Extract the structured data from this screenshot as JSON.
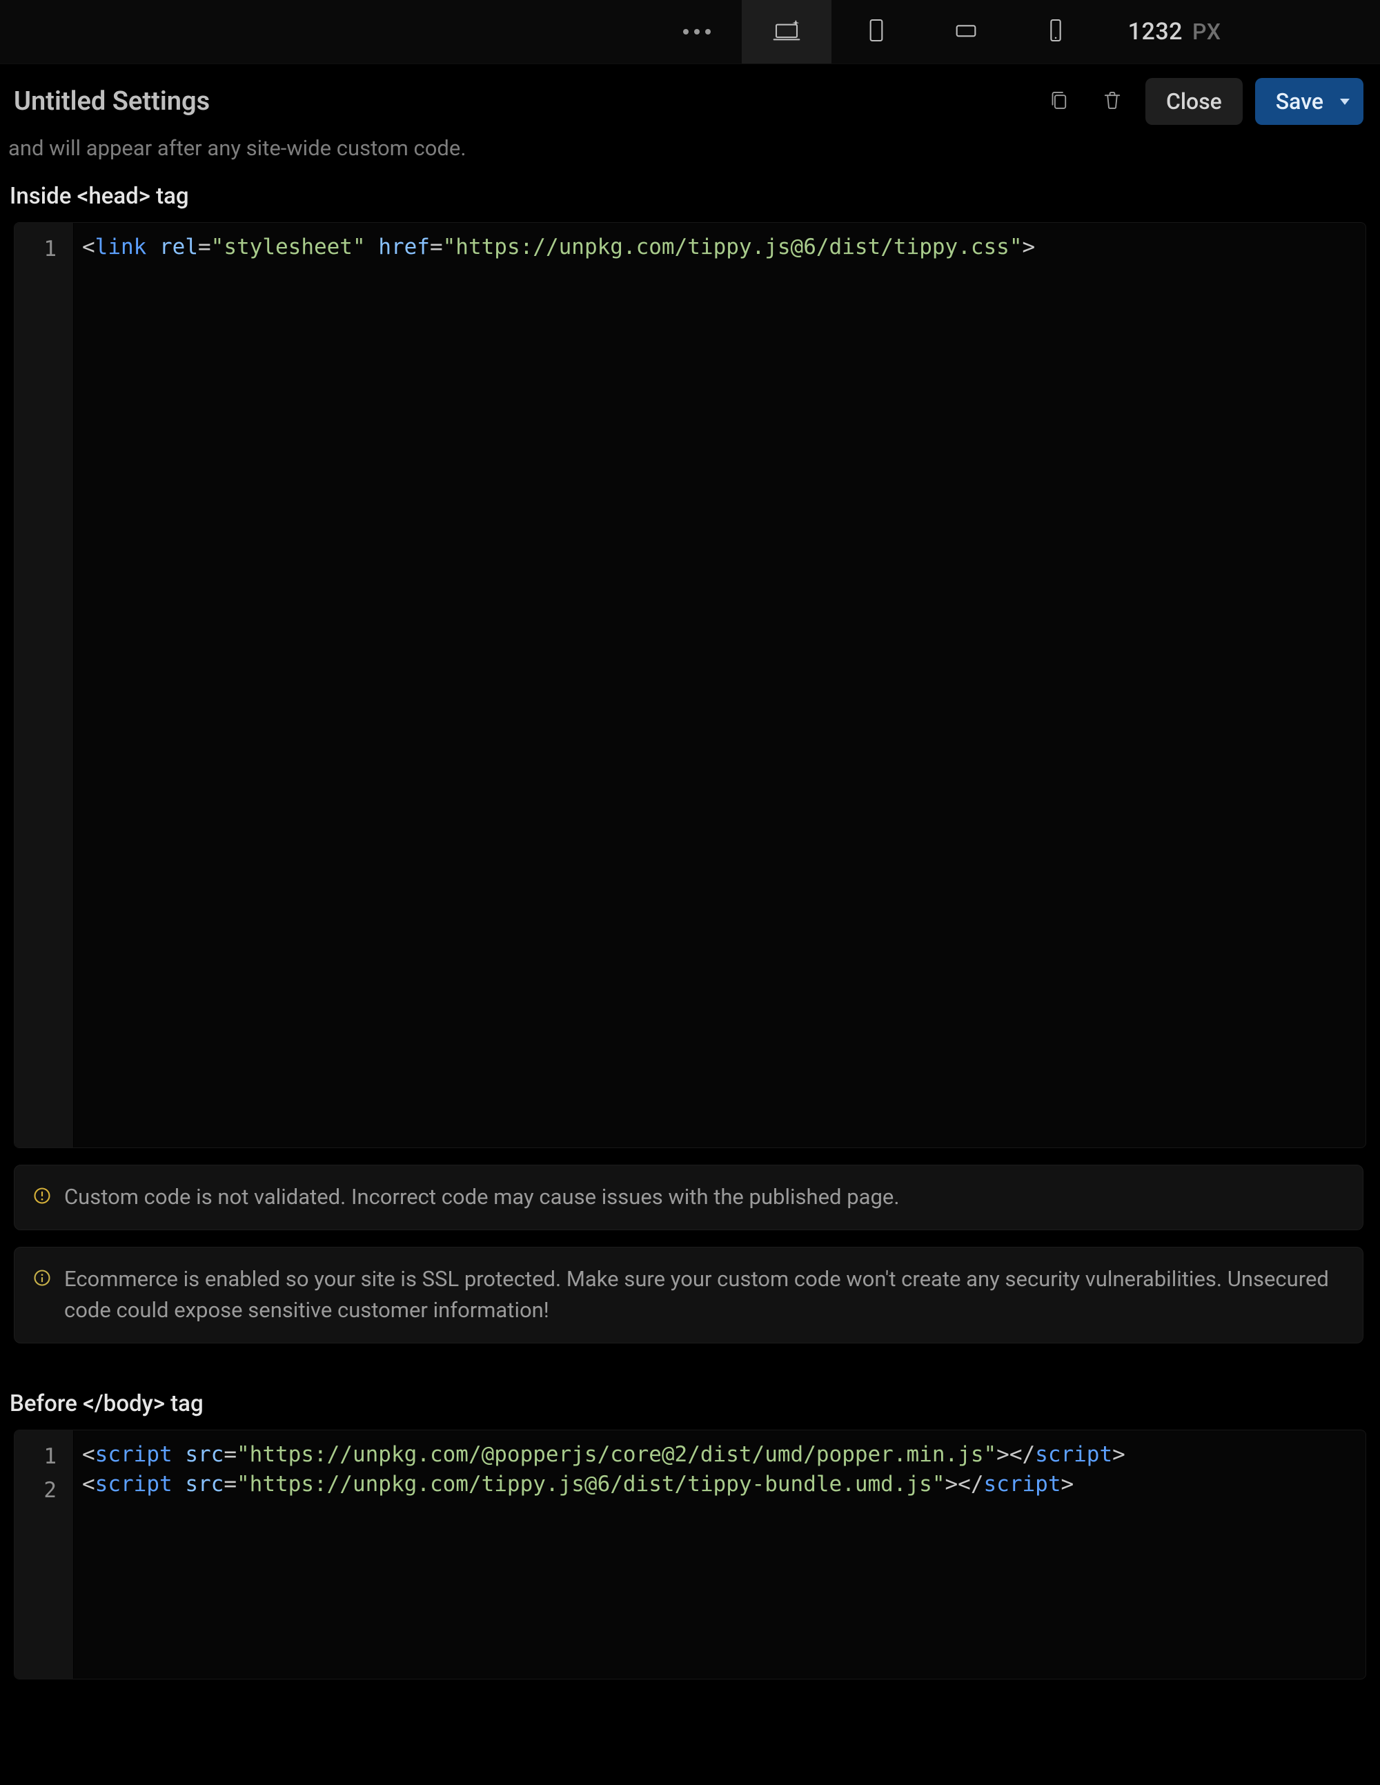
{
  "topbar": {
    "width_value": "1232",
    "width_unit": "PX"
  },
  "header": {
    "title": "Untitled Settings",
    "close_label": "Close",
    "save_label": "Save"
  },
  "subtext": "and will appear after any site-wide custom code.",
  "sections": {
    "head": {
      "label": "Inside <head> tag",
      "lines": [
        {
          "n": "1",
          "tokens": [
            {
              "c": "t-punc",
              "t": "<"
            },
            {
              "c": "t-tag",
              "t": "link"
            },
            {
              "c": "t-punc",
              "t": " "
            },
            {
              "c": "t-attr",
              "t": "rel"
            },
            {
              "c": "t-punc",
              "t": "="
            },
            {
              "c": "t-str",
              "t": "\"stylesheet\""
            },
            {
              "c": "t-punc",
              "t": " "
            },
            {
              "c": "t-attr",
              "t": "href"
            },
            {
              "c": "t-punc",
              "t": "="
            },
            {
              "c": "t-str",
              "t": "\"https://unpkg.com/tippy.js@6/dist/tippy.css\""
            },
            {
              "c": "t-punc",
              "t": ">"
            }
          ]
        }
      ]
    },
    "body": {
      "label": "Before </body> tag",
      "lines": [
        {
          "n": "1",
          "tokens": [
            {
              "c": "t-punc",
              "t": "<"
            },
            {
              "c": "t-tag",
              "t": "script"
            },
            {
              "c": "t-punc",
              "t": " "
            },
            {
              "c": "t-attr",
              "t": "src"
            },
            {
              "c": "t-punc",
              "t": "="
            },
            {
              "c": "t-str",
              "t": "\"https://unpkg.com/@popperjs/core@2/dist/umd/popper.min.js\""
            },
            {
              "c": "t-punc",
              "t": "></"
            },
            {
              "c": "t-tag",
              "t": "script"
            },
            {
              "c": "t-punc",
              "t": ">"
            }
          ]
        },
        {
          "n": "2",
          "tokens": [
            {
              "c": "t-punc",
              "t": "<"
            },
            {
              "c": "t-tag",
              "t": "script"
            },
            {
              "c": "t-punc",
              "t": " "
            },
            {
              "c": "t-attr",
              "t": "src"
            },
            {
              "c": "t-punc",
              "t": "="
            },
            {
              "c": "t-str",
              "t": "\"https://unpkg.com/tippy.js@6/dist/tippy-bundle.umd.js\""
            },
            {
              "c": "t-punc",
              "t": "></"
            },
            {
              "c": "t-tag",
              "t": "script"
            },
            {
              "c": "t-punc",
              "t": ">"
            }
          ]
        }
      ]
    }
  },
  "notices": {
    "validate": "Custom code is not validated. Incorrect code may cause issues with the published page.",
    "ssl": "Ecommerce is enabled so your site is SSL protected. Make sure your custom code won't create any security vulnerabilities. Unsecured code could expose sensitive customer information!"
  }
}
